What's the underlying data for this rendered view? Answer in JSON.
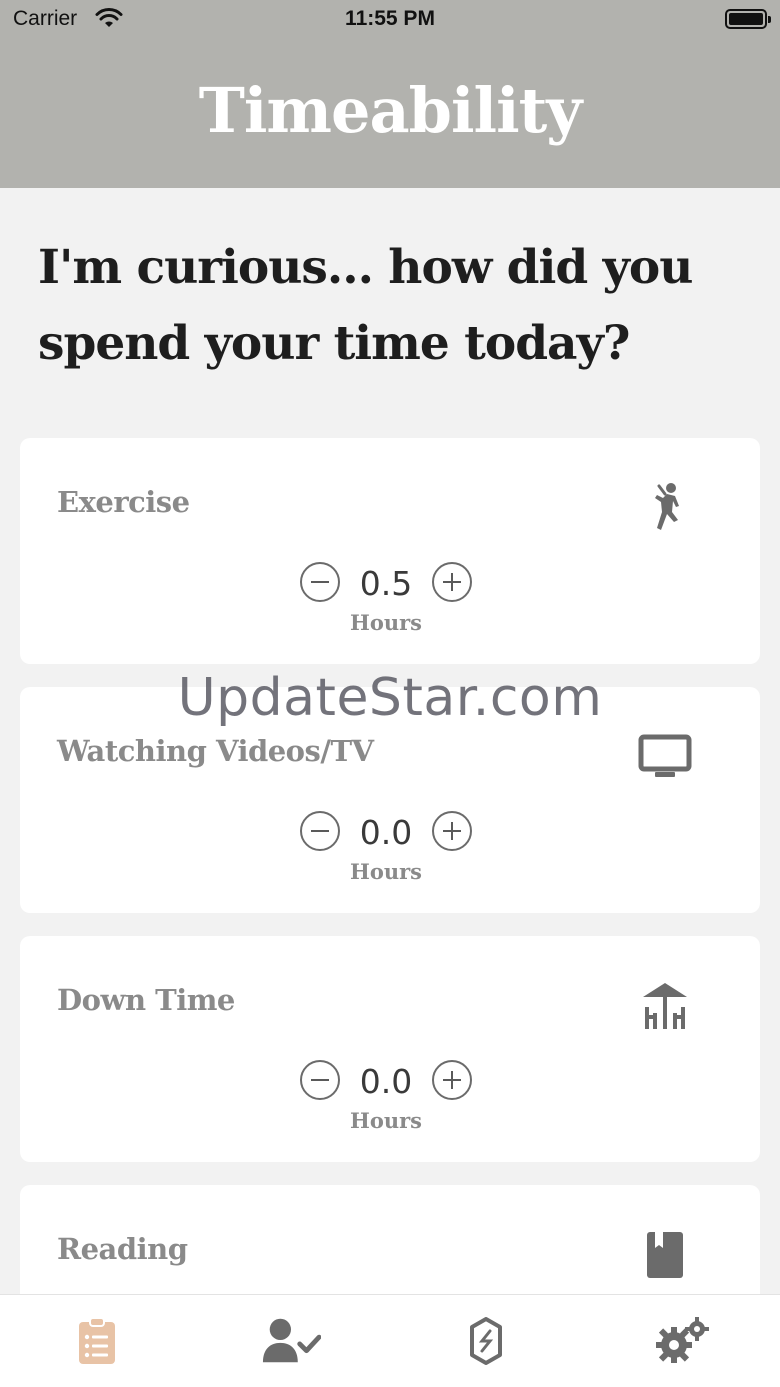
{
  "status": {
    "carrier": "Carrier",
    "time": "11:55 PM"
  },
  "app": {
    "title": "Timeability"
  },
  "prompt": {
    "line1": "I'm curious... how did you",
    "line2": "spend your time today?"
  },
  "activities": [
    {
      "name": "Exercise",
      "value": "0.5",
      "unit": "Hours",
      "icon": "exercise-icon"
    },
    {
      "name": "Watching Videos/TV",
      "value": "0.0",
      "unit": "Hours",
      "icon": "tv-icon"
    },
    {
      "name": "Down Time",
      "value": "0.0",
      "unit": "Hours",
      "icon": "downtime-icon"
    },
    {
      "name": "Reading",
      "icon": "book-icon"
    }
  ],
  "watermark": "UpdateStar.com",
  "tabs": [
    {
      "name": "log",
      "icon": "clipboard-list-icon",
      "active": true,
      "color": "#e8c3a6"
    },
    {
      "name": "profile",
      "icon": "user-check-icon",
      "active": false,
      "color": "#6b6b6b"
    },
    {
      "name": "tracker",
      "icon": "hourglass-icon",
      "active": false,
      "color": "#6b6b6b"
    },
    {
      "name": "settings",
      "icon": "gears-icon",
      "active": false,
      "color": "#6b6b6b"
    }
  ],
  "colors": {
    "header": "#b2b2ae",
    "background": "#f2f2f2",
    "accent": "#e8c3a6",
    "muted_text": "#8a8a8a"
  }
}
